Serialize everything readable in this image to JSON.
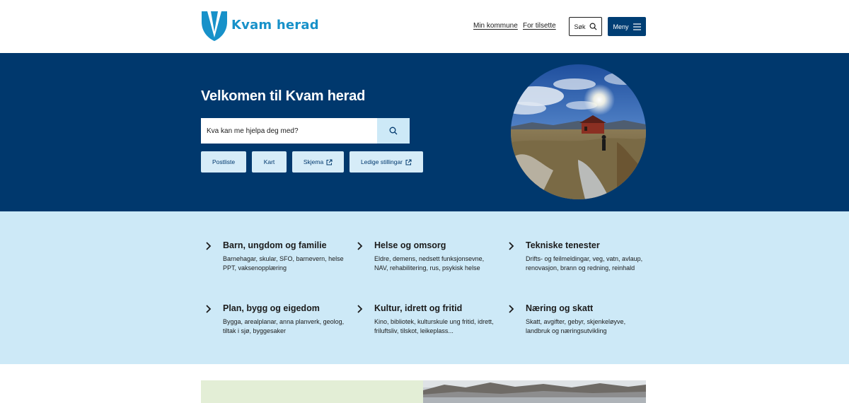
{
  "header": {
    "logo_text": "Kvam herad",
    "nav": {
      "min_kommune": "Min kommune",
      "for_tilsette": "For tilsette"
    },
    "search_button": "Søk",
    "menu_button": "Meny",
    "colors": {
      "brand": "#1791c9",
      "primary": "#003e74"
    }
  },
  "hero": {
    "title": "Velkomen til Kvam herad",
    "search": {
      "placeholder": "Kva kan me hjelpa deg med?",
      "value": ""
    },
    "quick_links": [
      {
        "label": "Postliste",
        "external": false
      },
      {
        "label": "Kart",
        "external": false
      },
      {
        "label": "Skjema",
        "external": true
      },
      {
        "label": "Ledige stillingar",
        "external": true
      }
    ],
    "background": "#00386d"
  },
  "categories": {
    "items": [
      {
        "title": "Barn, ungdom og familie",
        "description": "Barnehagar, skular, SFO, barnevern, helse PPT, vaksenopplæring"
      },
      {
        "title": "Helse og omsorg",
        "description": "Eldre, demens, nedsett funksjonsevne, NAV, rehabilitering, rus, psykisk helse"
      },
      {
        "title": "Tekniske tenester",
        "description": "Drifts- og feilmeldingar, veg, vatn, avlaup, renovasjon, brann og redning, reinhald"
      },
      {
        "title": "Plan, bygg og eigedom",
        "description": "Bygga, arealplanar, anna planverk, geolog, tiltak i sjø, byggesaker"
      },
      {
        "title": "Kultur, idrett og fritid",
        "description": "Kino, bibliotek, kulturskule ung fritid, idrett, friluftsliv, tilskot, leikeplass..."
      },
      {
        "title": "Næring og skatt",
        "description": "Skatt, avgifter, gebyr, skjenkeløyve, landbruk og næringsutvikling"
      }
    ],
    "background": "#cde9f7"
  }
}
